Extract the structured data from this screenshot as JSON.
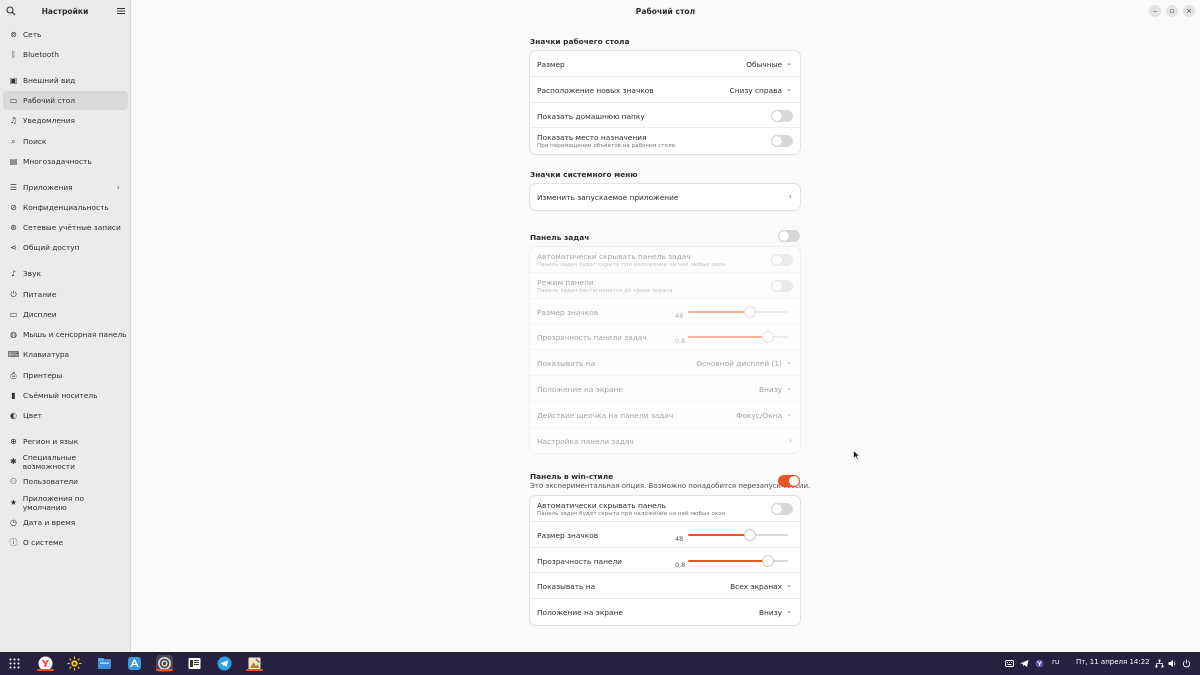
{
  "sidebar": {
    "title": "Настройки",
    "items": [
      {
        "label": "Сеть",
        "icon": "network-icon"
      },
      {
        "label": "Bluetooth",
        "icon": "bluetooth-icon"
      },
      {
        "label": "Внешний вид",
        "icon": "appearance-icon"
      },
      {
        "label": "Рабочий стол",
        "icon": "desktop-icon",
        "selected": true
      },
      {
        "label": "Уведомления",
        "icon": "bell-icon"
      },
      {
        "label": "Поиск",
        "icon": "search-icon"
      },
      {
        "label": "Многозадачность",
        "icon": "multitasking-icon"
      },
      {
        "label": "Приложения",
        "icon": "apps-icon",
        "chevron": true
      },
      {
        "label": "Конфиденциальность",
        "icon": "privacy-icon"
      },
      {
        "label": "Сетевые учётные записи",
        "icon": "online-accounts-icon"
      },
      {
        "label": "Общий доступ",
        "icon": "share-icon"
      },
      {
        "label": "Звук",
        "icon": "music-note-icon"
      },
      {
        "label": "Питание",
        "icon": "power-icon"
      },
      {
        "label": "Дисплеи",
        "icon": "display-icon"
      },
      {
        "label": "Мышь и сенсорная панель",
        "icon": "mouse-icon"
      },
      {
        "label": "Клавиатура",
        "icon": "keyboard-icon"
      },
      {
        "label": "Принтеры",
        "icon": "printer-icon"
      },
      {
        "label": "Съёмный носитель",
        "icon": "removable-media-icon"
      },
      {
        "label": "Цвет",
        "icon": "color-icon"
      },
      {
        "label": "Регион и язык",
        "icon": "region-icon"
      },
      {
        "label": "Специальные возможности",
        "icon": "accessibility-icon"
      },
      {
        "label": "Пользователи",
        "icon": "users-icon"
      },
      {
        "label": "Приложения по умолчанию",
        "icon": "star-icon"
      },
      {
        "label": "Дата и время",
        "icon": "clock-icon"
      },
      {
        "label": "О системе",
        "icon": "info-icon"
      }
    ]
  },
  "header": {
    "title": "Рабочий стол"
  },
  "desktop_icons": {
    "title": "Значки рабочего стола",
    "size_label": "Размер",
    "size_value": "Обычные",
    "position_label": "Расположение новых значков",
    "position_value": "Снизу справа",
    "home_label": "Показать домашнюю папку",
    "home_on": false,
    "dest_label": "Показать место назначения",
    "dest_sub": "При перемещении объектов на рабочем столе.",
    "dest_on": false
  },
  "system_menu": {
    "title": "Значки системного меню",
    "launcher_label": "Изменить запускаемое приложение"
  },
  "taskbar_panel": {
    "title": "Панель задач",
    "enabled": false,
    "autohide_label": "Автоматически скрывать панель задач",
    "autohide_sub": "Панель задач будет скрыта при наложении на неё любых окон.",
    "mode_label": "Режим панели",
    "mode_sub": "Панель задач растягивается до краев экрана.",
    "icon_size_label": "Размер значков",
    "icon_size_value": "48",
    "icon_size_fraction": 0.62,
    "opacity_label": "Прозрачность панели задач",
    "opacity_value": "0,8",
    "opacity_fraction": 0.8,
    "show_on_label": "Показывать на",
    "show_on_value": "Основной дисплей (1)",
    "position_label": "Положение на экране",
    "position_value": "Внизу",
    "click_label": "Действие щелчка на панели задач",
    "click_value": "Фокус/Окна",
    "config_label": "Настройка панели задач"
  },
  "win_panel": {
    "title": "Панель в win-стиле",
    "subtitle": "Это экспериментальная опция. Возможно понадобится перезапуск сессии.",
    "enabled": true,
    "autohide_label": "Автоматически скрывать панель",
    "autohide_sub": "Панель задач будет скрыта при наложении на неё любых окон.",
    "icon_size_label": "Размер значков",
    "icon_size_value": "48",
    "icon_size_fraction": 0.62,
    "opacity_label": "Прозрачность панели",
    "opacity_value": "0,8",
    "opacity_fraction": 0.8,
    "show_on_label": "Показывать на",
    "show_on_value": "Всех экранах",
    "position_label": "Положение на экране",
    "position_value": "Внизу"
  },
  "taskbar": {
    "lang": "ru",
    "clock": "Пт, 11 апреля 14:22",
    "accent": "#e95420",
    "background": "#27213f"
  }
}
